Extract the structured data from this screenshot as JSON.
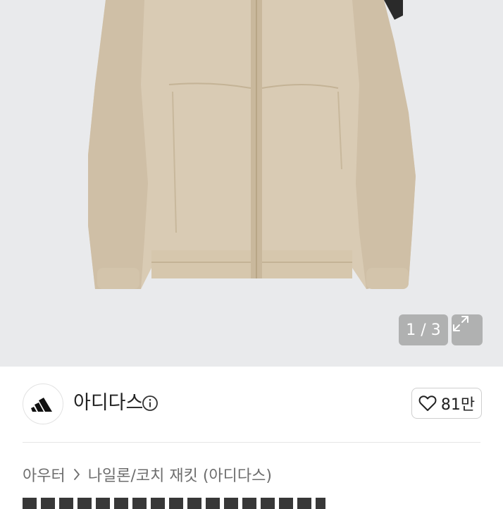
{
  "image_viewer": {
    "counter": "1 / 3",
    "expand_icon": "expand-icon",
    "product_colors": {
      "jacket": "#d9cbb4",
      "background": "#e9eaec"
    }
  },
  "seller": {
    "brand_name": "아디다스",
    "logo_icon": "adidas-logo",
    "info_icon": "info-circle-icon"
  },
  "like": {
    "icon": "heart-outline-icon",
    "count": "81만"
  },
  "breadcrumb": {
    "items": [
      "아우터",
      "나일론/코치 재킷 (아디다스)"
    ],
    "separator_icon": "chevron-right-icon"
  }
}
